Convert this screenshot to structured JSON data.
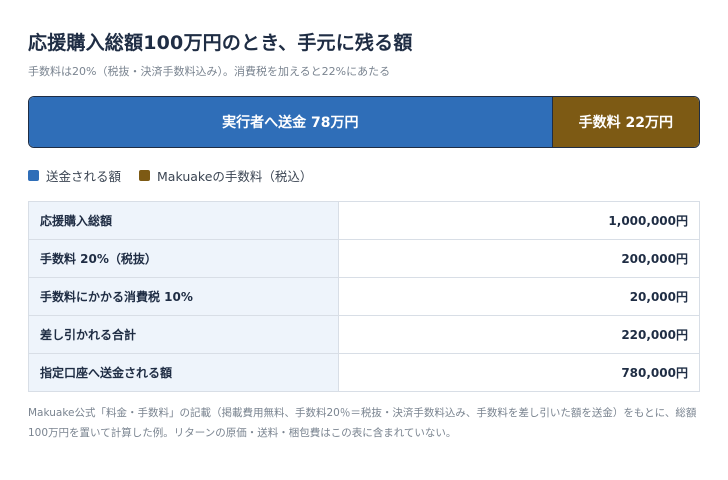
{
  "title": "応援購入総額100万円のとき、手元に残る額",
  "subtitle": "手数料は20%（税抜・決済手数料込み）。消費税を加えると22%にあたる",
  "colors": {
    "sent": "#2f6eb8",
    "fee": "#7d5a14"
  },
  "chart_data": {
    "type": "bar",
    "orientation": "horizontal-stacked",
    "total": 100,
    "segments": [
      {
        "key": "sent",
        "label": "実行者へ送金 78万円",
        "value": 78
      },
      {
        "key": "fee",
        "label": "手数料 22万円",
        "value": 22
      }
    ],
    "legend": {
      "placement": "bottom-left",
      "entries": [
        {
          "key": "sent",
          "label": "送金される額"
        },
        {
          "key": "fee",
          "label": "Makuakeの手数料（税込）"
        }
      ]
    }
  },
  "table": {
    "rows": [
      {
        "label": "応援購入総額",
        "value": "1,000,000円"
      },
      {
        "label": "手数料 20%（税抜）",
        "value": "200,000円"
      },
      {
        "label": "手数料にかかる消費税 10%",
        "value": "20,000円"
      },
      {
        "label": "差し引かれる合計",
        "value": "220,000円"
      },
      {
        "label": "指定口座へ送金される額",
        "value": "780,000円"
      }
    ]
  },
  "note": "Makuake公式「料金・手数料」の記載（掲載費用無料、手数料20％＝税抜・決済手数料込み、手数料を差し引いた額を送金）をもとに、総額100万円を置いて計算した例。リターンの原価・送料・梱包費はこの表に含まれていない。"
}
